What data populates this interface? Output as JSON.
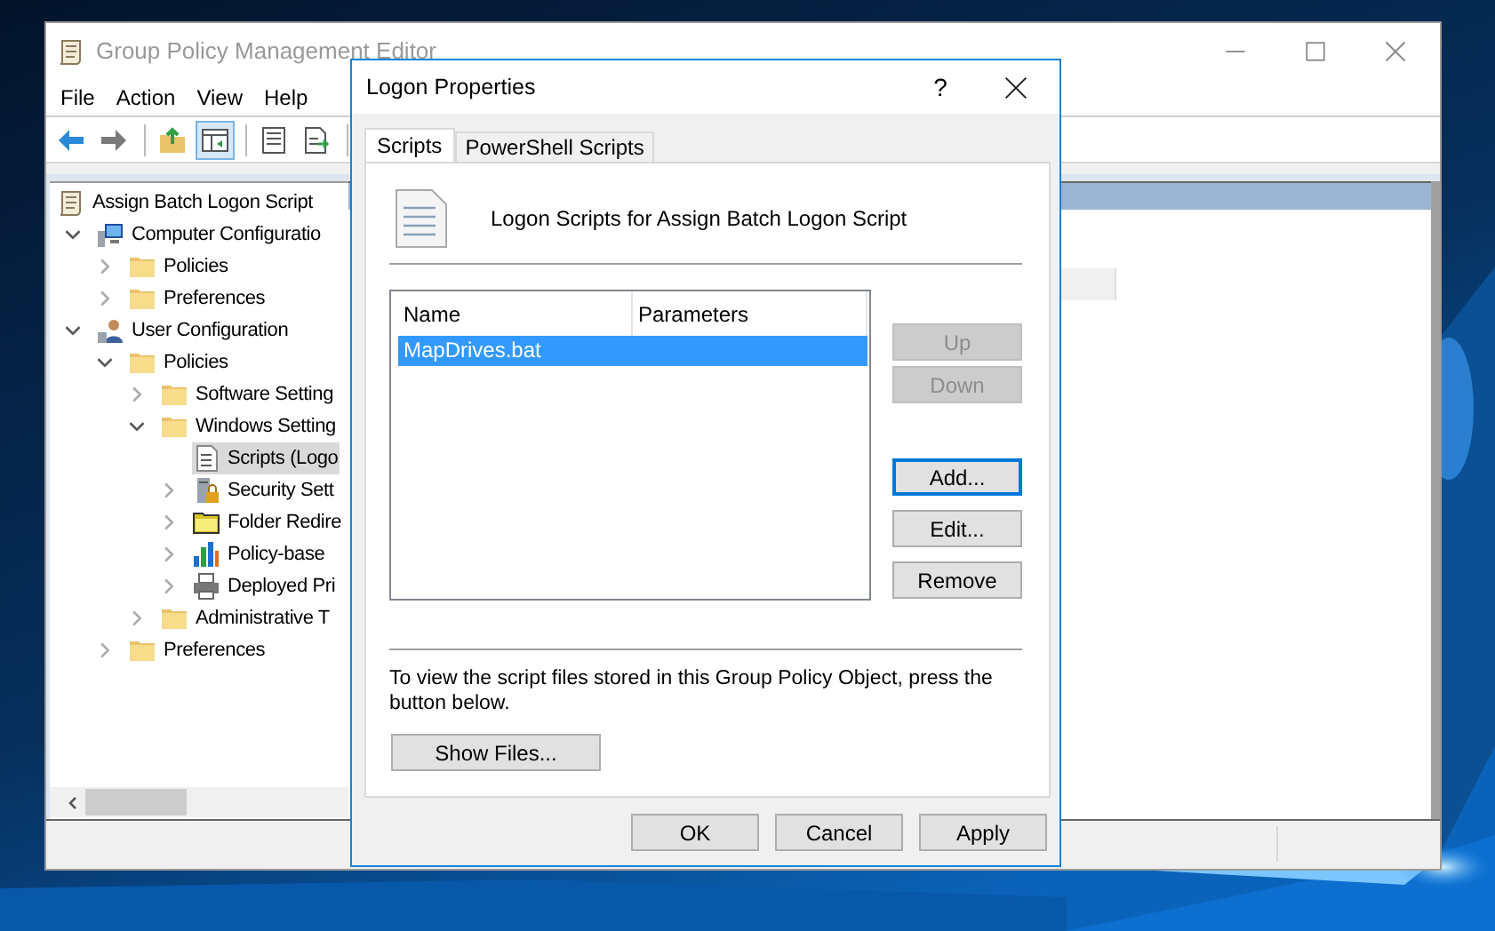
{
  "main_window": {
    "title": "Group Policy Management Editor",
    "menu": [
      "File",
      "Action",
      "View",
      "Help"
    ],
    "toolbar": [
      {
        "kind": "back",
        "pressed": false
      },
      {
        "kind": "forward",
        "pressed": false
      },
      {
        "kind": "separator"
      },
      {
        "kind": "up-folder",
        "pressed": false
      },
      {
        "kind": "tree-pane",
        "pressed": true
      },
      {
        "kind": "separator"
      },
      {
        "kind": "properties",
        "pressed": false
      },
      {
        "kind": "export",
        "pressed": false
      },
      {
        "kind": "separator"
      }
    ],
    "tree": [
      {
        "label": "Assign Batch Logon Script",
        "kind": "snap-in",
        "selected": false,
        "children": [
          {
            "label": "Computer Configuratio",
            "kind": "computer",
            "expanded": true,
            "selected": false,
            "children": [
              {
                "label": "Policies",
                "kind": "folder",
                "expanded": false,
                "selected": false
              },
              {
                "label": "Preferences",
                "kind": "folder",
                "expanded": false,
                "selected": false
              }
            ]
          },
          {
            "label": "User Configuration",
            "kind": "user",
            "expanded": true,
            "selected": false,
            "children": [
              {
                "label": "Policies",
                "kind": "folder",
                "expanded": true,
                "selected": false,
                "children": [
                  {
                    "label": "Software Setting",
                    "kind": "folder",
                    "expanded": false,
                    "selected": false
                  },
                  {
                    "label": "Windows Setting",
                    "kind": "folder",
                    "expanded": true,
                    "selected": false,
                    "children": [
                      {
                        "label": "Scripts (Logo",
                        "kind": "script",
                        "selected": true
                      },
                      {
                        "label": "Security Sett",
                        "kind": "security",
                        "expanded": false,
                        "selected": false
                      },
                      {
                        "label": "Folder Redire",
                        "kind": "redirect-folder",
                        "expanded": false,
                        "selected": false
                      },
                      {
                        "label": "Policy-base",
                        "kind": "chart",
                        "expanded": false,
                        "selected": false
                      },
                      {
                        "label": "Deployed Pri",
                        "kind": "printer",
                        "expanded": false,
                        "selected": false
                      }
                    ]
                  },
                  {
                    "label": "Administrative T",
                    "kind": "folder",
                    "expanded": false,
                    "selected": false
                  }
                ]
              },
              {
                "label": "Preferences",
                "kind": "folder",
                "expanded": false,
                "selected": false
              }
            ]
          }
        ]
      }
    ]
  },
  "dialog": {
    "title": "Logon Properties",
    "help": "?",
    "tabs": [
      {
        "label": "Scripts",
        "selected": true
      },
      {
        "label": "PowerShell Scripts",
        "selected": false
      }
    ],
    "heading": "Logon Scripts for Assign Batch Logon Script",
    "columns": [
      "Name",
      "Parameters"
    ],
    "rows": [
      {
        "name": "MapDrives.bat",
        "selected": true
      }
    ],
    "side_buttons": [
      {
        "label": "Up",
        "disabled": true,
        "focused": false
      },
      {
        "label": "Down",
        "disabled": true,
        "focused": false
      },
      {
        "label": "Add...",
        "disabled": false,
        "focused": true
      },
      {
        "label": "Edit...",
        "disabled": false,
        "focused": false
      },
      {
        "label": "Remove",
        "disabled": false,
        "focused": false
      }
    ],
    "note": "To view the script files stored in this Group Policy Object, press the button below.",
    "show_files_button": "Show Files...",
    "buttons": [
      "OK",
      "Cancel",
      "Apply"
    ]
  }
}
